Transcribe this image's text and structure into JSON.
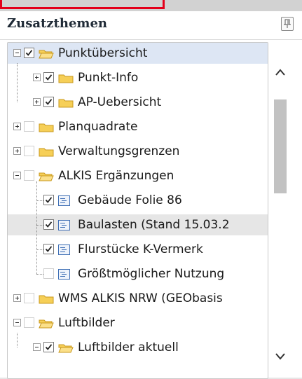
{
  "panel": {
    "title": "Zusatzthemen",
    "pin_icon": "pin-icon"
  },
  "tree": {
    "items": [
      {
        "label": "Punktübersicht",
        "level": 0,
        "expander": "minus",
        "checked": true,
        "icon": "folder-open-icon",
        "highlighted": true
      },
      {
        "label": "Punkt-Info",
        "level": 1,
        "expander": "plus",
        "checked": true,
        "icon": "folder-icon"
      },
      {
        "label": "AP-Uebersicht",
        "level": 1,
        "expander": "plus",
        "checked": true,
        "icon": "folder-icon"
      },
      {
        "label": "Planquadrate",
        "level": 0,
        "expander": "plus",
        "checked": false,
        "icon": "folder-icon"
      },
      {
        "label": "Verwaltungsgrenzen",
        "level": 0,
        "expander": "plus",
        "checked": false,
        "icon": "folder-icon"
      },
      {
        "label": "ALKIS Ergänzungen",
        "level": 0,
        "expander": "minus",
        "checked": false,
        "icon": "folder-open-icon"
      },
      {
        "label": "Gebäude Folie 86",
        "level": 1,
        "checked": true,
        "icon": "layer-icon"
      },
      {
        "label": "Baulasten (Stand 15.03.2",
        "level": 1,
        "checked": true,
        "icon": "layer-icon",
        "hover": true
      },
      {
        "label": "Flurstücke K-Vermerk",
        "level": 1,
        "checked": true,
        "icon": "layer-icon"
      },
      {
        "label": "Größtmöglicher Nutzung",
        "level": 1,
        "checked": false,
        "icon": "layer-icon"
      },
      {
        "label": "WMS ALKIS NRW (GEObasis",
        "level": 0,
        "expander": "plus",
        "checked": false,
        "icon": "folder-icon"
      },
      {
        "label": "Luftbilder",
        "level": 0,
        "expander": "minus",
        "checked": false,
        "icon": "folder-open-icon"
      },
      {
        "label": "Luftbilder aktuell",
        "level": 1,
        "expander": "minus",
        "checked": true,
        "icon": "folder-open-icon"
      }
    ]
  },
  "scrollbar": {
    "up_icon": "chevron-up-icon",
    "down_icon": "chevron-down-icon",
    "position": 0.12
  },
  "colors": {
    "accent_highlight": "#dde6f4",
    "folder": "#f3c64a",
    "layer_icon": "#3f6fb5",
    "annotation_red": "#e4001b"
  }
}
